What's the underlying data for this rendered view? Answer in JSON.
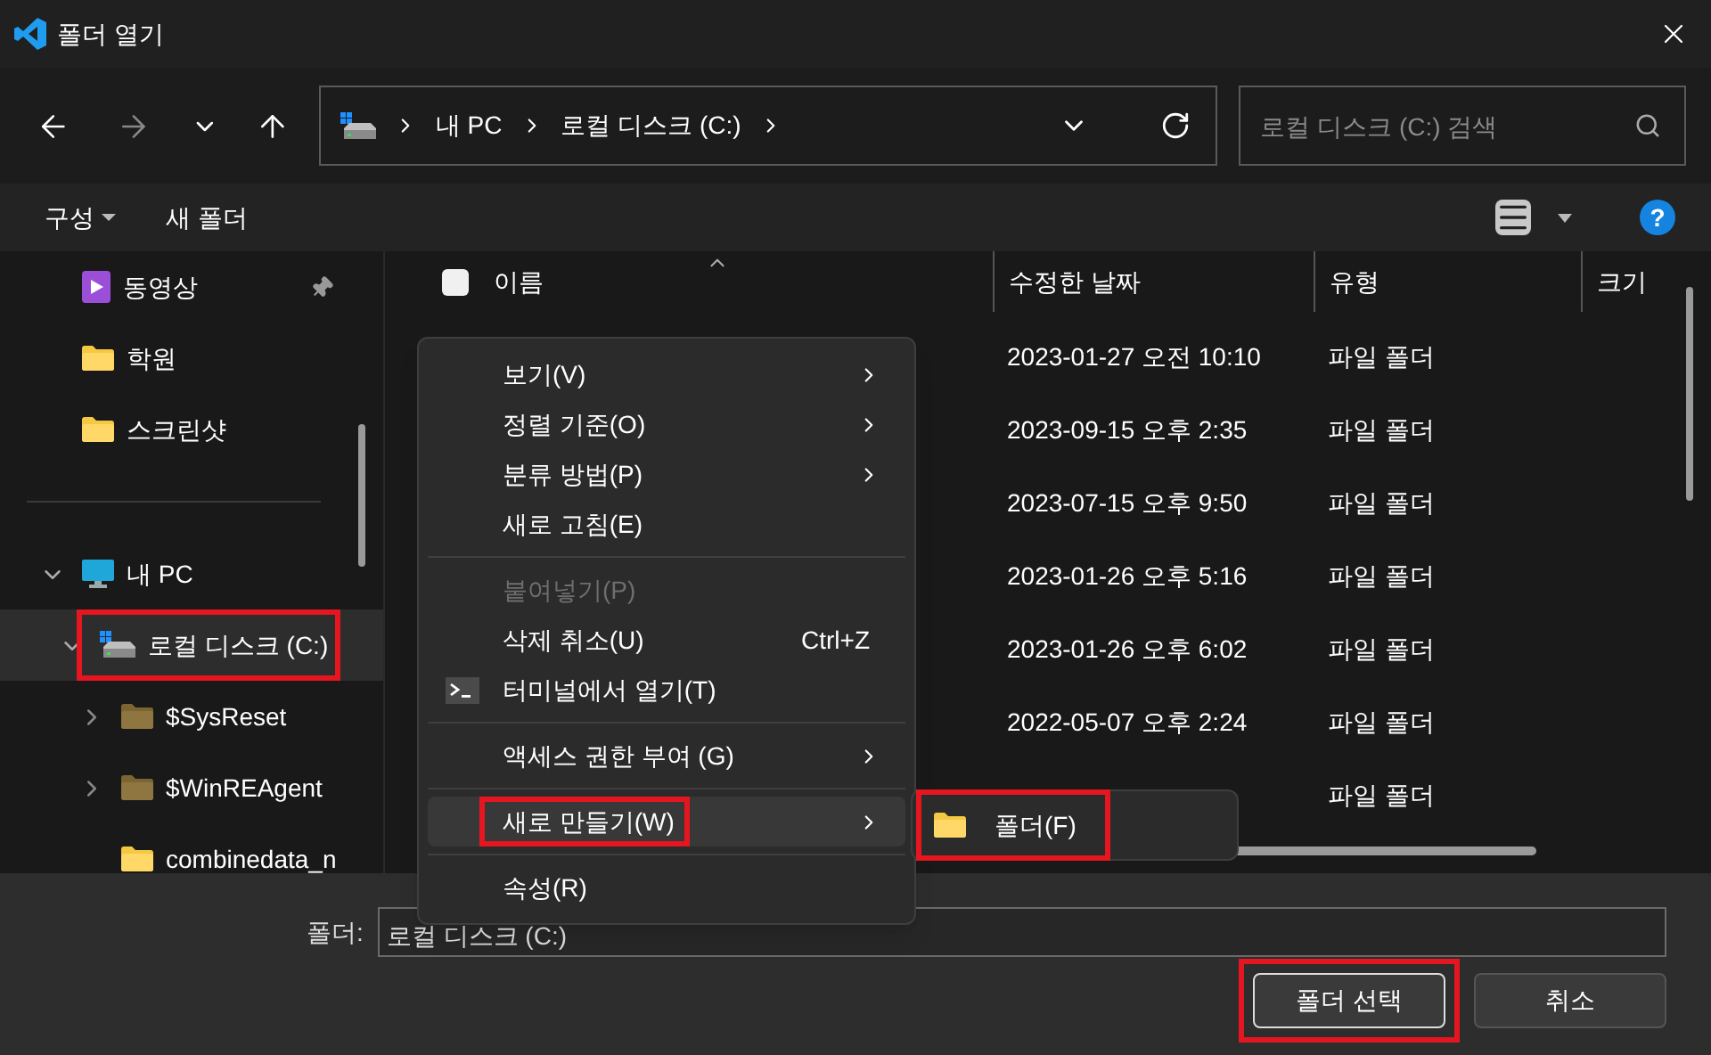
{
  "window": {
    "title": "폴더 열기"
  },
  "nav": {
    "breadcrumbs": [
      "내 PC",
      "로컬 디스크 (C:)"
    ],
    "search": {
      "placeholder": "로컬 디스크 (C:) 검색"
    }
  },
  "command_bar": {
    "organize": "구성",
    "new_folder": "새 폴더",
    "help": "?"
  },
  "sidebar": {
    "quick_access": [
      {
        "label": "동영상",
        "kind": "videos",
        "pinned": true
      },
      {
        "label": "학원",
        "kind": "folder",
        "pinned": false
      },
      {
        "label": "스크린샷",
        "kind": "folder",
        "pinned": false
      }
    ],
    "tree": [
      {
        "label": "내 PC",
        "kind": "pc",
        "expanded": true,
        "selected": false,
        "highlighted": false,
        "children": [
          {
            "label": "로컬 디스크 (C:)",
            "kind": "drive",
            "expanded": true,
            "selected": true,
            "highlighted": true,
            "children": [
              {
                "label": "$SysReset",
                "kind": "system_folder",
                "expanded": false,
                "selected": false,
                "highlighted": false
              },
              {
                "label": "$WinREAgent",
                "kind": "system_folder",
                "expanded": false,
                "selected": false,
                "highlighted": false
              },
              {
                "label": "combinedata_n",
                "kind": "folder",
                "selected": false,
                "highlighted": false
              }
            ]
          }
        ]
      }
    ]
  },
  "table": {
    "select_all": {
      "checked": false
    },
    "columns": [
      {
        "label": "이름",
        "sorted": true
      },
      {
        "label": "수정한 날짜"
      },
      {
        "label": "유형"
      },
      {
        "label": "크기"
      }
    ],
    "rows": [
      {
        "modified": "2023-01-27 오전 10:10",
        "type": "파일 폴더"
      },
      {
        "modified": "2023-09-15 오후 2:35",
        "type": "파일 폴더"
      },
      {
        "modified": "2023-07-15 오후 9:50",
        "type": "파일 폴더"
      },
      {
        "modified": "2023-01-26 오후 5:16",
        "type": "파일 폴더"
      },
      {
        "modified": "2023-01-26 오후 6:02",
        "type": "파일 폴더"
      },
      {
        "modified": "2022-05-07 오후 2:24",
        "type": "파일 폴더"
      },
      {
        "type": "파일 폴더"
      }
    ]
  },
  "context_menu": {
    "items": [
      {
        "kind": "item",
        "label": "보기(V)",
        "submenu": true,
        "disabled": false,
        "selected": false,
        "highlighted": false
      },
      {
        "kind": "item",
        "label": "정렬 기준(O)",
        "submenu": true,
        "disabled": false,
        "selected": false,
        "highlighted": false
      },
      {
        "kind": "item",
        "label": "분류 방법(P)",
        "submenu": true,
        "disabled": false,
        "selected": false,
        "highlighted": false
      },
      {
        "kind": "item",
        "label": "새로 고침(E)",
        "submenu": false,
        "disabled": false,
        "selected": false,
        "highlighted": false
      },
      {
        "kind": "separator"
      },
      {
        "kind": "item",
        "label": "붙여넣기(P)",
        "submenu": false,
        "disabled": true,
        "selected": false,
        "highlighted": false
      },
      {
        "kind": "item",
        "label": "삭제 취소(U)",
        "shortcut": "Ctrl+Z",
        "submenu": false,
        "disabled": false,
        "selected": false,
        "highlighted": false
      },
      {
        "kind": "item",
        "label": "터미널에서 열기(T)",
        "has_icon": true,
        "submenu": false,
        "disabled": false,
        "selected": false,
        "highlighted": false
      },
      {
        "kind": "separator"
      },
      {
        "kind": "item",
        "label": "액세스 권한 부여 (G)",
        "submenu": true,
        "disabled": false,
        "selected": false,
        "highlighted": false
      },
      {
        "kind": "separator"
      },
      {
        "kind": "item",
        "label": "새로 만들기(W)",
        "submenu": true,
        "disabled": false,
        "selected": true,
        "highlighted": true
      },
      {
        "kind": "separator"
      },
      {
        "kind": "item",
        "label": "속성(R)",
        "submenu": false,
        "disabled": false,
        "selected": false,
        "highlighted": false
      }
    ]
  },
  "submenu": {
    "items": [
      {
        "label": "폴더(F)",
        "highlighted": true
      }
    ]
  },
  "footer": {
    "folder_label": "폴더:",
    "folder_value": "로컬 디스크 (C:)",
    "buttons": [
      {
        "label": "폴더 선택",
        "kind": "primary",
        "highlighted": true
      },
      {
        "label": "취소",
        "kind": "secondary",
        "highlighted": false
      }
    ]
  }
}
